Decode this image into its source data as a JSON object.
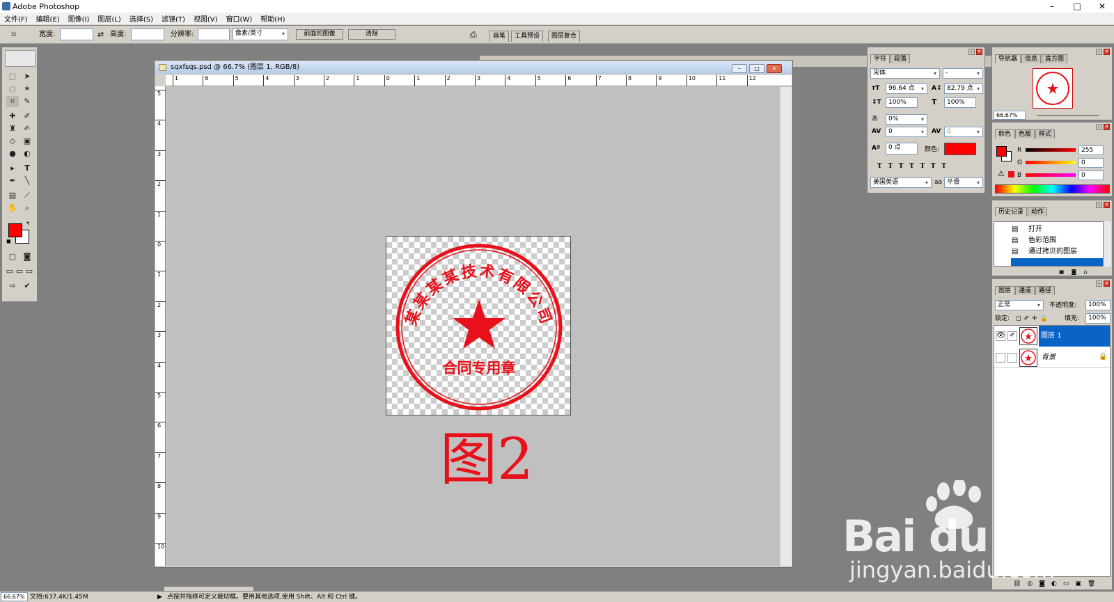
{
  "app": {
    "title": "Adobe Photoshop"
  },
  "window_controls": [
    "–",
    "□",
    "✕"
  ],
  "menu": [
    "文件(F)",
    "编辑(E)",
    "图像(I)",
    "图层(L)",
    "选择(S)",
    "滤镜(T)",
    "视图(V)",
    "窗口(W)",
    "帮助(H)"
  ],
  "options": {
    "width_label": "宽度:",
    "height_label": "高度:",
    "res_label": "分辨率:",
    "unit": "像素/英寸",
    "front_image": "前面的图像",
    "clear": "清除",
    "tabs": [
      "画笔",
      "工具预设",
      "图层复合"
    ]
  },
  "document": {
    "title": "sqxfsqs.psd @ 66.7% (图层 1, RGB/8)",
    "ruler_h": [
      "1",
      "6",
      "5",
      "4",
      "3",
      "2",
      "1",
      "0",
      "1",
      "2",
      "3",
      "4",
      "5",
      "6",
      "7",
      "8",
      "9",
      "10",
      "11",
      "12"
    ],
    "ruler_v": [
      "5",
      "4",
      "3",
      "2",
      "1",
      "0",
      "1",
      "2",
      "3",
      "4",
      "5",
      "6",
      "7",
      "8",
      "9",
      "10"
    ]
  },
  "stamp": {
    "ring_text": "某某某某技术有限公司",
    "bottom_text": "合同专用章"
  },
  "figure_label": "图2",
  "char_panel": {
    "tabs": [
      "字符",
      "段落"
    ],
    "font": "宋体",
    "style": "-",
    "size": "96.64 点",
    "leading": "82.79 点",
    "vscale": "100%",
    "hscale": "100%",
    "tracking_pct": "0%",
    "kerning": "0",
    "tracking": "0",
    "baseline": "0 点",
    "color_label": "颜色:",
    "language": "美国英语",
    "aa_label": "aa",
    "antialias": "平滑"
  },
  "nav_panel": {
    "tabs": [
      "导航器",
      "信息",
      "直方图"
    ],
    "zoom": "66.67%"
  },
  "color_panel": {
    "tabs": [
      "颜色",
      "色板",
      "样式"
    ],
    "r_label": "R",
    "g_label": "G",
    "b_label": "B",
    "r": "255",
    "g": "0",
    "b": "0"
  },
  "history_panel": {
    "tabs": [
      "历史记录",
      "动作"
    ],
    "items": [
      "打开",
      "色彩范围",
      "通过拷贝的图层"
    ]
  },
  "layers_panel": {
    "tabs": [
      "图层",
      "通道",
      "路径"
    ],
    "mode": "正常",
    "opacity_label": "不透明度:",
    "opacity": "100%",
    "lock_label": "锁定:",
    "fill_label": "填充:",
    "fill": "100%",
    "layers": [
      "图层 1",
      "背景"
    ]
  },
  "status": {
    "zoom": "66.67%",
    "doc": "文档:637.4K/1.45M",
    "hint": "点按并拖移可定义裁切框。要用其他选项,使用 Shift、Alt 和 Ctrl 键。"
  },
  "watermark": {
    "brand": "Bai du 经验",
    "url": "jingyan.baidu.com"
  },
  "colors": {
    "fg": "#ff0000",
    "stamp": "#e8101a",
    "layer_sel": "#0a64c8"
  }
}
